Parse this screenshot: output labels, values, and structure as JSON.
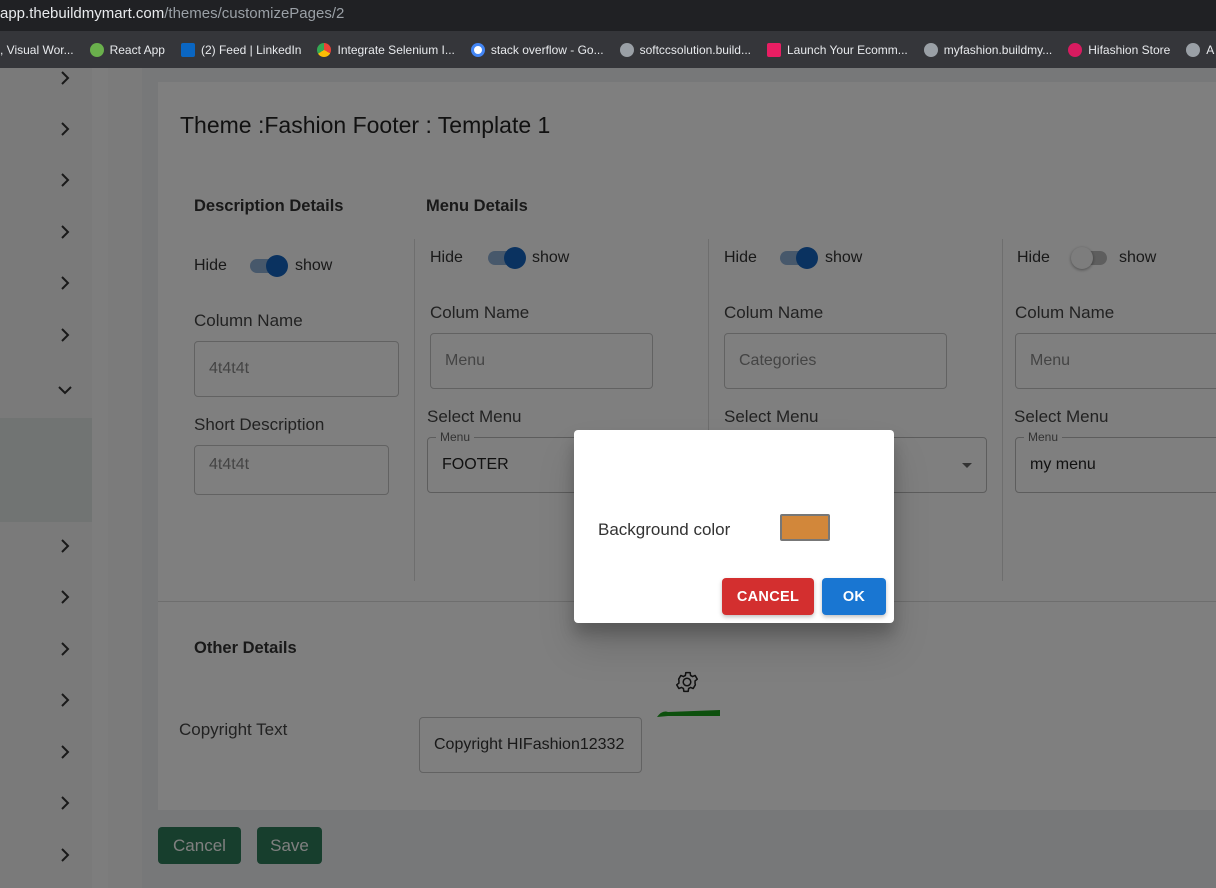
{
  "browser": {
    "url_host": "app.thebuildmymart.com",
    "url_path": "/themes/customizePages/2",
    "bookmarks": [
      {
        "label": ", Visual Wor...",
        "icon": "vscode-icon",
        "color": "#3b82f6"
      },
      {
        "label": "React App",
        "icon": "react-icon",
        "color": "#6ab04c"
      },
      {
        "label": "(2) Feed | LinkedIn",
        "icon": "linkedin-icon",
        "color": "#0a66c2"
      },
      {
        "label": "Integrate Selenium I...",
        "icon": "chrome-icon",
        "color": "#f4b400"
      },
      {
        "label": "stack overflow - Go...",
        "icon": "google-icon",
        "color": "#ffffff"
      },
      {
        "label": "softccsolution.build...",
        "icon": "globe-icon",
        "color": "#9aa0a6"
      },
      {
        "label": "Launch Your Ecomm...",
        "icon": "store-icon",
        "color": "#e91e63"
      },
      {
        "label": "myfashion.buildmy...",
        "icon": "globe-icon",
        "color": "#9aa0a6"
      },
      {
        "label": "Hifashion Store",
        "icon": "hifashion-icon",
        "color": "#d81b60"
      },
      {
        "label": "A",
        "icon": "globe-icon",
        "color": "#9aa0a6"
      }
    ]
  },
  "page": {
    "title": "Theme :Fashion Footer : Template 1"
  },
  "description": {
    "section_title": "Description Details",
    "hide_label": "Hide",
    "show_label": "show",
    "column_name_label": "Column Name",
    "column_name_value": "4t4t4t",
    "short_desc_label": "Short Description",
    "short_desc_value": "4t4t4t"
  },
  "menu": {
    "section_title": "Menu Details",
    "columns": [
      {
        "hide": "Hide",
        "show": "show",
        "toggle_on": true,
        "colum_name_label": "Colum Name",
        "colum_name_value": "Menu",
        "select_menu_label": "Select Menu",
        "legend": "Menu",
        "selected": "FOOTER"
      },
      {
        "hide": "Hide",
        "show": "show",
        "toggle_on": true,
        "colum_name_label": "Colum Name",
        "colum_name_value": "Categories",
        "select_menu_label": "Select Menu",
        "legend": "",
        "selected": ""
      },
      {
        "hide": "Hide",
        "show": "show",
        "toggle_on": false,
        "colum_name_label": "Colum Name",
        "colum_name_value": "Menu",
        "select_menu_label": "Select Menu",
        "legend": "Menu",
        "selected": "my menu"
      }
    ]
  },
  "other": {
    "section_title": "Other Details",
    "copyright_label": "Copyright Text",
    "copyright_value": "Copyright HIFashion12332",
    "settings_icon": "gear-icon"
  },
  "actions": {
    "cancel": "Cancel",
    "save": "Save"
  },
  "dialog": {
    "label": "Background color",
    "color": "#d2873a",
    "cancel": "CANCEL",
    "ok": "OK"
  },
  "colors": {
    "primary": "#1976d2",
    "danger": "#d32f2f",
    "success": "#2e7d5b",
    "annotation": "#1aa01a"
  }
}
